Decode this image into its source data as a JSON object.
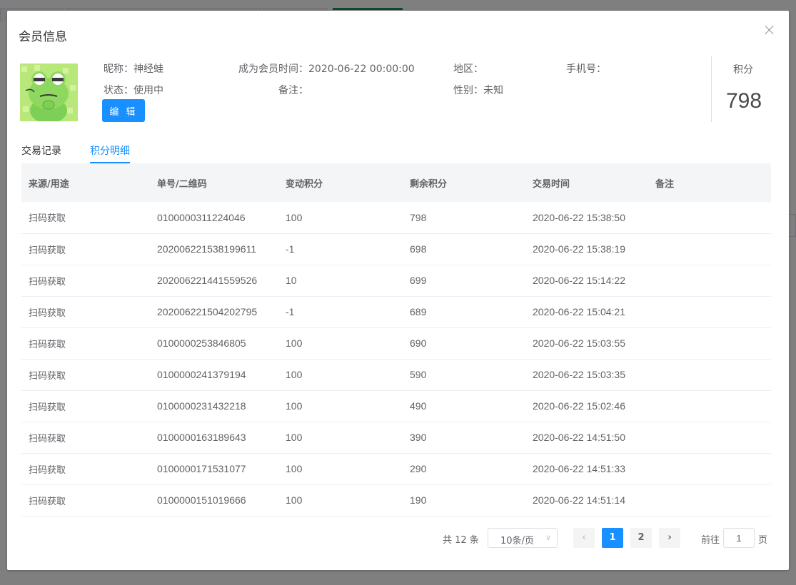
{
  "dialog": {
    "title": "会员信息",
    "profile": {
      "nickname": "昵称：神经蛙",
      "member_since": "成为会员时间：2020-06-22 00:00:00",
      "region": "地区：",
      "phone": "手机号：",
      "status": "状态：使用中",
      "remark": "备注：",
      "gender": "性别：未知",
      "edit_label": "编 辑"
    },
    "score": {
      "label": "积分",
      "value": "798"
    },
    "tabs": [
      {
        "label": "交易记录",
        "active": false
      },
      {
        "label": "积分明细",
        "active": true
      }
    ],
    "table": {
      "headers": [
        "来源/用途",
        "单号/二维码",
        "变动积分",
        "剩余积分",
        "交易时间",
        "备注"
      ],
      "rows": [
        [
          "扫码获取",
          "0100000311224046",
          "100",
          "798",
          "2020-06-22 15:38:50",
          ""
        ],
        [
          "扫码获取",
          "202006221538199611",
          "-1",
          "698",
          "2020-06-22 15:38:19",
          ""
        ],
        [
          "扫码获取",
          "202006221441559526",
          "10",
          "699",
          "2020-06-22 15:14:22",
          ""
        ],
        [
          "扫码获取",
          "202006221504202795",
          "-1",
          "689",
          "2020-06-22 15:04:21",
          ""
        ],
        [
          "扫码获取",
          "0100000253846805",
          "100",
          "690",
          "2020-06-22 15:03:55",
          ""
        ],
        [
          "扫码获取",
          "0100000241379194",
          "100",
          "590",
          "2020-06-22 15:03:35",
          ""
        ],
        [
          "扫码获取",
          "0100000231432218",
          "100",
          "490",
          "2020-06-22 15:02:46",
          ""
        ],
        [
          "扫码获取",
          "0100000163189643",
          "100",
          "390",
          "2020-06-22 14:51:50",
          ""
        ],
        [
          "扫码获取",
          "0100000171531077",
          "100",
          "290",
          "2020-06-22 14:51:33",
          ""
        ],
        [
          "扫码获取",
          "0100000151019666",
          "100",
          "190",
          "2020-06-22 14:51:14",
          ""
        ]
      ]
    },
    "pagination": {
      "total": "共 12 条",
      "page_size": "10条/页",
      "pages": [
        "1",
        "2"
      ],
      "current": "1",
      "goto_label": "前往",
      "goto_value": "1",
      "goto_suffix": "页"
    }
  },
  "colors": {
    "primary": "#1890ff",
    "background_tab_accent": "#1e8f5a"
  }
}
